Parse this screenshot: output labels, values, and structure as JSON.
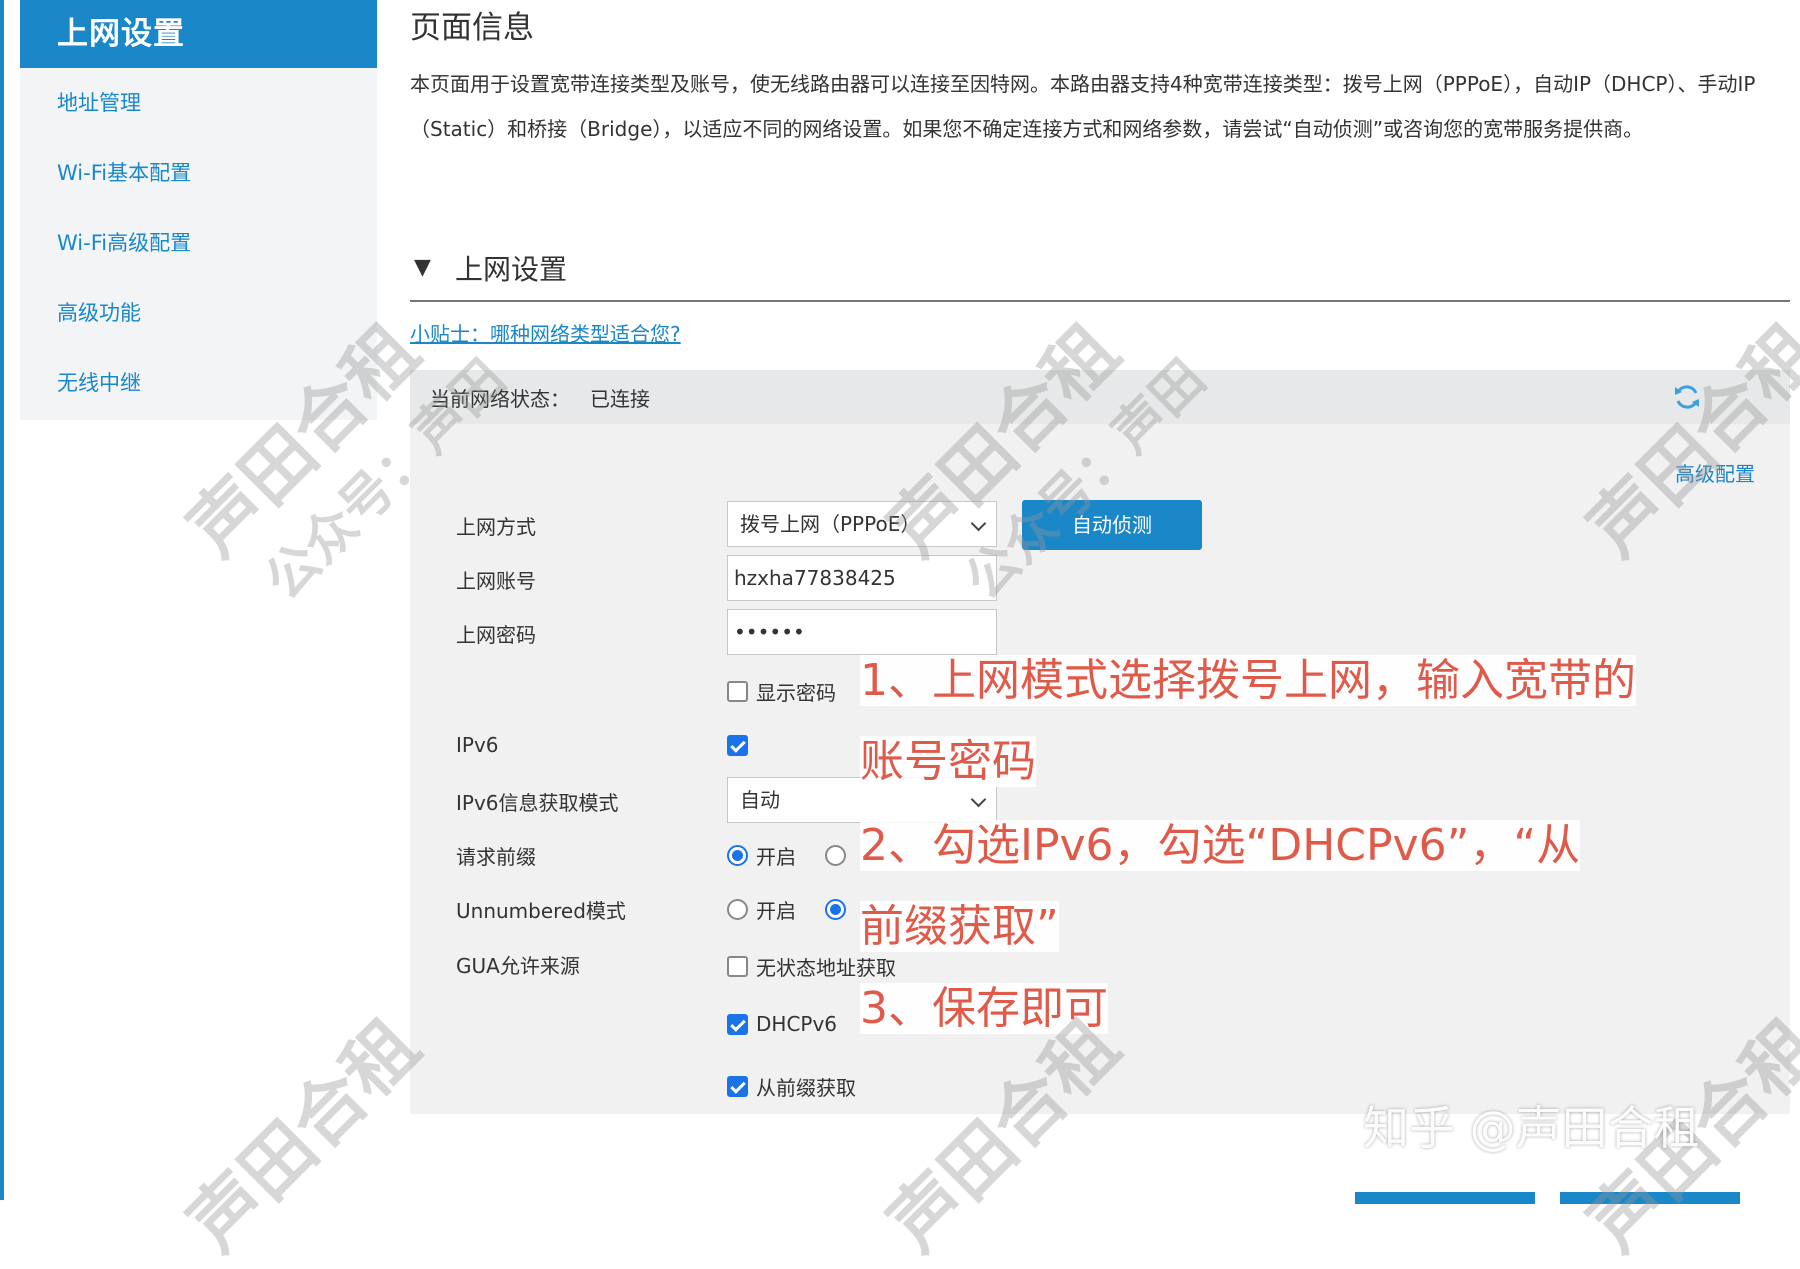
{
  "sidebar": {
    "header": "上网设置",
    "items": [
      {
        "label": "地址管理"
      },
      {
        "label": "Wi-Fi基本配置"
      },
      {
        "label": "Wi-Fi高级配置"
      },
      {
        "label": "高级功能"
      },
      {
        "label": "无线中继"
      }
    ]
  },
  "main": {
    "title": "页面信息",
    "description": "本页面用于设置宽带连接类型及账号，使无线路由器可以连接至因特网。本路由器支持4种宽带连接类型：拨号上网（PPPoE），自动IP（DHCP）、手动IP（Static）和桥接（Bridge），以适应不同的网络设置。如果您不确定连接方式和网络参数，请尝试“自动侦测”或咨询您的宽带服务提供商。",
    "section_title": "上网设置",
    "tip_link": "小贴士：哪种网络类型适合您?",
    "status_label": "当前网络状态：",
    "status_value": "已连接",
    "advanced_link": "高级配置"
  },
  "form": {
    "mode_label": "上网方式",
    "mode_value": "拨号上网（PPPoE）",
    "auto_detect_button": "自动侦测",
    "account_label": "上网账号",
    "account_value": "hzxha77838425",
    "password_label": "上网密码",
    "password_value": "••••••",
    "show_password_label": "显示密码",
    "show_password_checked": false,
    "ipv6_label": "IPv6",
    "ipv6_checked": true,
    "ipv6_mode_label": "IPv6信息获取模式",
    "ipv6_mode_value": "自动",
    "request_prefix_label": "请求前缀",
    "request_prefix_on_label": "开启",
    "unnumbered_label": "Unnumbered模式",
    "unnumbered_on_label": "开启",
    "gua_label": "GUA允许来源",
    "stateless_label": "无状态地址获取",
    "stateless_checked": false,
    "dhcpv6_label": "DHCPv6",
    "dhcpv6_checked": true,
    "from_prefix_label": "从前缀获取",
    "from_prefix_checked": true
  },
  "annotations": {
    "step1_line1": "1、上网模式选择拨号上网，输入宽带的",
    "step1_line2": "账号密码",
    "step2_line1": "2、勾选IPv6，勾选“DHCPv6”，“从",
    "step2_line2": "前缀获取”",
    "step3": "3、保存即可"
  },
  "watermark": {
    "brand": "声田合租",
    "account": "公众号：声田",
    "zhihu": "知乎 @声田合租"
  },
  "colors": {
    "accent": "#1a87c9",
    "annotation": "#e05a4a",
    "checkbox": "#1a73e8"
  }
}
